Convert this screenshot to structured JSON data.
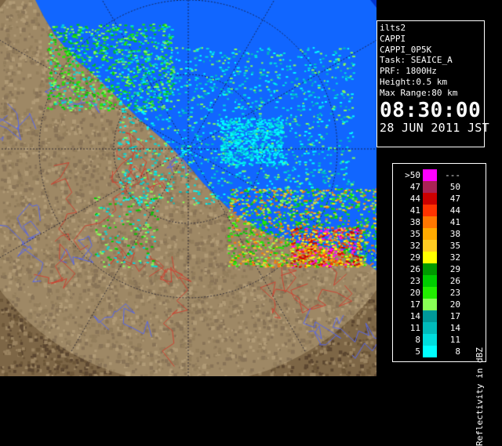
{
  "info": {
    "lines": [
      "ilts2",
      "CAPPI",
      "CAPPI_0P5K",
      "Task: SEAICE_A",
      "PRF: 1800Hz",
      "Height:0.5 km",
      "Max Range:80 km"
    ],
    "time": "08:30:00",
    "date": "28 JUN 2011 JST"
  },
  "legend": {
    "unit_label": "Reflectivity in dBZ",
    "rows": [
      {
        "low": ">50",
        "high": "---",
        "color": "#ff00ff"
      },
      {
        "low": "47",
        "high": "50",
        "color": "#aa2255"
      },
      {
        "low": "44",
        "high": "47",
        "color": "#cc0000"
      },
      {
        "low": "41",
        "high": "44",
        "color": "#ff3300"
      },
      {
        "low": "38",
        "high": "41",
        "color": "#ff7700"
      },
      {
        "low": "35",
        "high": "38",
        "color": "#ffaa00"
      },
      {
        "low": "32",
        "high": "35",
        "color": "#ffcc22"
      },
      {
        "low": "29",
        "high": "32",
        "color": "#ffff00"
      },
      {
        "low": "26",
        "high": "29",
        "color": "#009900"
      },
      {
        "low": "23",
        "high": "26",
        "color": "#00cc00"
      },
      {
        "low": "20",
        "high": "23",
        "color": "#22ee00"
      },
      {
        "low": "17",
        "high": "20",
        "color": "#88ff55"
      },
      {
        "low": "14",
        "high": "17",
        "color": "#009999"
      },
      {
        "low": "11",
        "high": "14",
        "color": "#00bbbb"
      },
      {
        "low": "8",
        "high": "11",
        "color": "#00dddd"
      },
      {
        "low": "5",
        "high": "8",
        "color": "#00ffff"
      }
    ]
  },
  "colors": {
    "sea": "#0033cc",
    "coverage": "#1166ff",
    "land": "#7d6646",
    "land_in_range": "#b8a27c"
  }
}
